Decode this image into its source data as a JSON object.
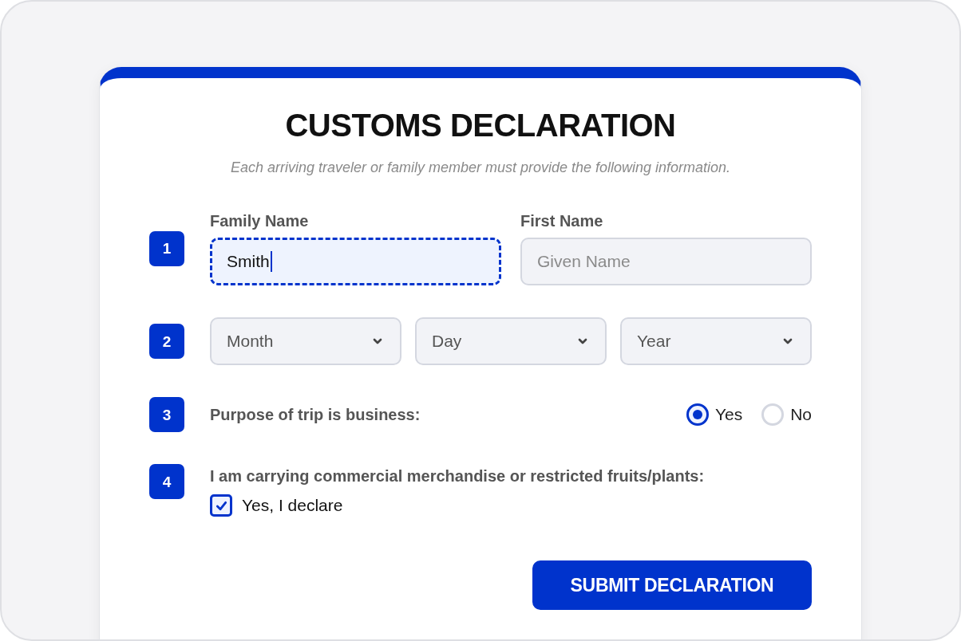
{
  "title": "CUSTOMS DECLARATION",
  "subtitle": "Each arriving traveler or family member must provide the following information.",
  "sections": [
    {
      "number": "1",
      "kind": "names",
      "fields": [
        {
          "label": "Family Name",
          "value": "Smith",
          "focused": true
        },
        {
          "label": "First Name",
          "placeholder": "Given Name",
          "focused": false
        }
      ]
    },
    {
      "number": "2",
      "kind": "date",
      "selects": [
        {
          "placeholder": "Month"
        },
        {
          "placeholder": "Day"
        },
        {
          "placeholder": "Year"
        }
      ]
    },
    {
      "number": "3",
      "kind": "radio",
      "question": "Purpose of trip is business:",
      "options": [
        {
          "label": "Yes",
          "selected": true
        },
        {
          "label": "No",
          "selected": false
        }
      ]
    },
    {
      "number": "4",
      "kind": "checkbox",
      "question": "I am carrying commercial merchandise or restricted fruits/plants:",
      "option": {
        "label": "Yes, I declare",
        "checked": true
      }
    }
  ],
  "submit": {
    "label": "SUBMIT DECLARATION"
  }
}
